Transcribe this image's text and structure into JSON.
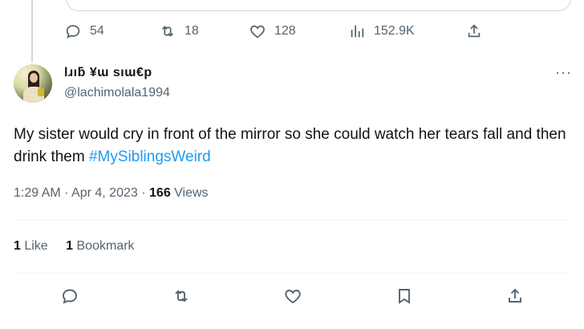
{
  "previous_tweet": {
    "replies": "54",
    "retweets": "18",
    "likes": "128",
    "views": "152.9K"
  },
  "tweet": {
    "display_name": "lɹıƃ ¥ɯ sıɯ€p",
    "handle": "@lachimolala1994",
    "more_label": "···",
    "text_main": "My sister would cry in front of the mirror so she could watch her tears fall and then drink them ",
    "hashtag": "#MySiblingsWeird",
    "time": "1:29 AM",
    "date": "Apr 4, 2023",
    "views_count": "166",
    "views_label": " Views",
    "likes_count": "1",
    "likes_label": " Like",
    "bookmarks_count": "1",
    "bookmarks_label": " Bookmark"
  },
  "colors": {
    "accent": "#1d9bf0",
    "secondary_text": "#536471",
    "divider": "#eff3f4"
  }
}
